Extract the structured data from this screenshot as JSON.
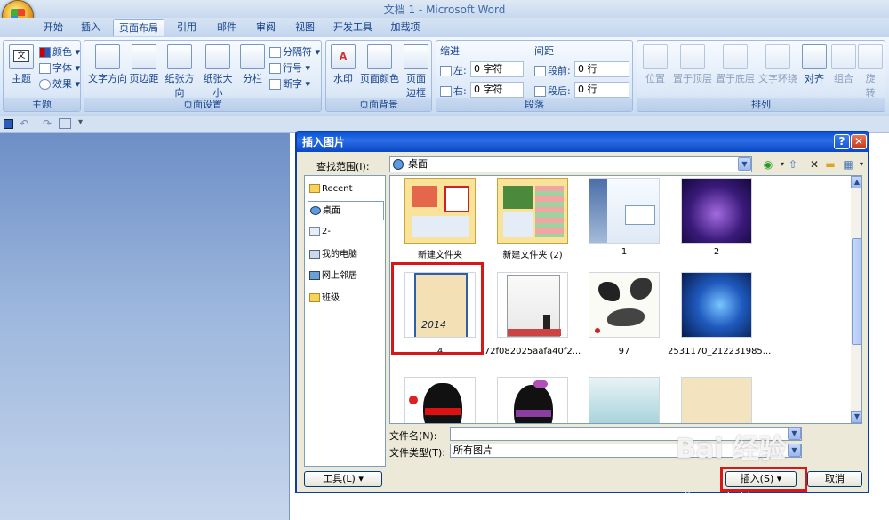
{
  "window": {
    "title": "文档 1 - Microsoft Word"
  },
  "tabs": [
    "开始",
    "插入",
    "页面布局",
    "引用",
    "邮件",
    "审阅",
    "视图",
    "开发工具",
    "加载项"
  ],
  "ribbon": {
    "theme_group": {
      "label": "主题",
      "theme_btn": "主题",
      "colors": "颜色",
      "fonts": "字体",
      "effects": "效果"
    },
    "page_setup": {
      "label": "页面设置",
      "text_dir": "文字方向",
      "margins": "页边距",
      "orientation": "纸张方向",
      "size": "纸张大小",
      "columns": "分栏",
      "breaks": "分隔符",
      "line_numbers": "行号",
      "hyphenation": "断字"
    },
    "page_background": {
      "label": "页面背景",
      "watermark": "水印",
      "page_color": "页面颜色",
      "page_borders_1": "页面",
      "page_borders_2": "边框"
    },
    "paragraph": {
      "label": "段落",
      "indent": "缩进",
      "spacing": "间距",
      "left": "左:",
      "right": "右:",
      "before": "段前:",
      "after": "段后:",
      "left_val": "0 字符",
      "right_val": "0 字符",
      "before_val": "0 行",
      "after_val": "0 行"
    },
    "arrange": {
      "label": "排列",
      "position": "位置",
      "bring_front": "置于顶层",
      "send_back": "置于底层",
      "wrap": "文字环绕",
      "align": "对齐",
      "group": "组合",
      "rotate_1": "旋",
      "rotate_2": "转"
    }
  },
  "dialog": {
    "title": "插入图片",
    "help": "?",
    "close": "✕",
    "lookin_label": "查找范围(I):",
    "lookin_value": "桌面",
    "places": [
      "Recent",
      "桌面",
      "2-",
      "我的电脑",
      "网上邻居",
      "班级"
    ],
    "files": [
      {
        "label": "新建文件夹"
      },
      {
        "label": "新建文件夹 (2)"
      },
      {
        "label": "1"
      },
      {
        "label": "2"
      },
      {
        "label": "4"
      },
      {
        "label": "72f082025aafa40f2..."
      },
      {
        "label": "97"
      },
      {
        "label": "2531170_212231985..."
      },
      {
        "label": ""
      },
      {
        "label": ""
      },
      {
        "label": ""
      },
      {
        "label": ""
      }
    ],
    "filename_label": "文件名(N):",
    "filename_value": "",
    "filetype_label": "文件类型(T):",
    "filetype_value": "所有图片",
    "tools_btn": "工具(L)",
    "insert_btn": "插入(S)",
    "cancel_btn": "取消"
  },
  "watermark": {
    "text": "Bai 经验",
    "url": "jingyan.baidu.com"
  },
  "colors": {
    "highlight": "#d61818",
    "title_bar": "#0a53d8"
  }
}
